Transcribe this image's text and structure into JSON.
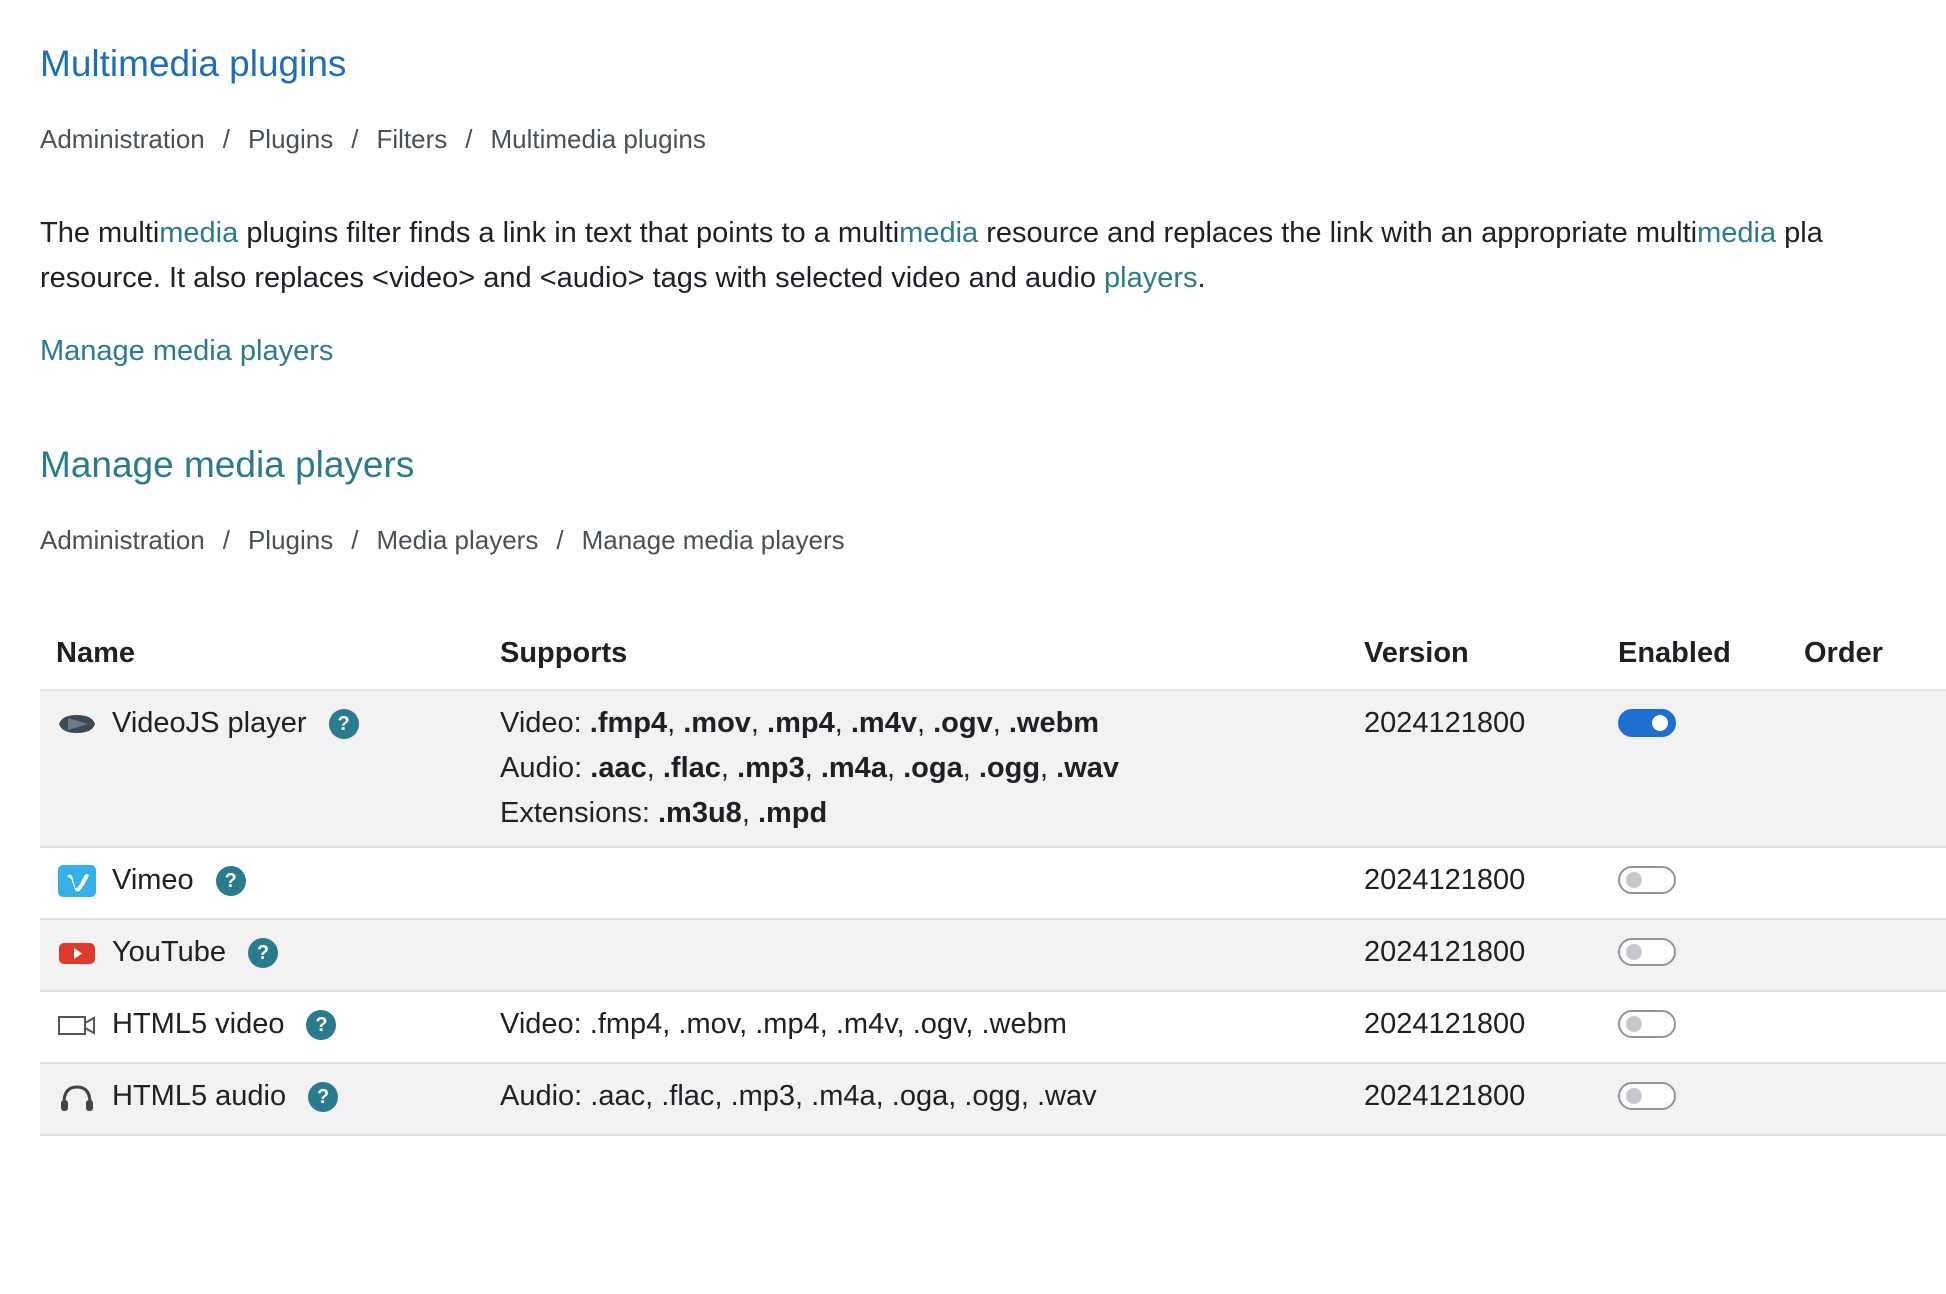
{
  "filter_section": {
    "title": "Multimedia plugins",
    "breadcrumb": [
      "Administration",
      "Plugins",
      "Filters",
      "Multimedia plugins"
    ],
    "breadcrumb_separator": "/",
    "description": {
      "line1": [
        {
          "text": "The multi",
          "highlight": false
        },
        {
          "text": "media",
          "highlight": true
        },
        {
          "text": " plugins filter finds a link in text that points to a multi",
          "highlight": false
        },
        {
          "text": "media",
          "highlight": true
        },
        {
          "text": " resource and replaces the link with an appropriate multi",
          "highlight": false
        },
        {
          "text": "media",
          "highlight": true
        },
        {
          "text": " pla",
          "highlight": false
        }
      ],
      "line2": [
        {
          "text": "resource. It also replaces <video> and <audio> tags with selected video and audio ",
          "highlight": false
        },
        {
          "text": "players",
          "highlight": true
        },
        {
          "text": ".",
          "highlight": false
        }
      ]
    },
    "manage_link": "Manage media players"
  },
  "players_section": {
    "title": "Manage media players",
    "breadcrumb": [
      "Administration",
      "Plugins",
      "Media players",
      "Manage media players"
    ],
    "breadcrumb_separator": "/"
  },
  "table": {
    "headers": {
      "name": "Name",
      "supports": "Supports",
      "version": "Version",
      "enabled": "Enabled",
      "order": "Order"
    },
    "rows": [
      {
        "name": "VideoJS player",
        "icon": "videojs-icon",
        "supports_bold": true,
        "supports": [
          {
            "label": "Video: ",
            "formats": [
              ".fmp4",
              ".mov",
              ".mp4",
              ".m4v",
              ".ogv",
              ".webm"
            ]
          },
          {
            "label": "Audio: ",
            "formats": [
              ".aac",
              ".flac",
              ".mp3",
              ".m4a",
              ".oga",
              ".ogg",
              ".wav"
            ]
          },
          {
            "label": "Extensions: ",
            "formats": [
              ".m3u8",
              ".mpd"
            ]
          }
        ],
        "version": "2024121800",
        "enabled": true
      },
      {
        "name": "Vimeo",
        "icon": "vimeo-icon",
        "supports_bold": false,
        "supports": [],
        "version": "2024121800",
        "enabled": false
      },
      {
        "name": "YouTube",
        "icon": "youtube-icon",
        "supports_bold": false,
        "supports": [],
        "version": "2024121800",
        "enabled": false
      },
      {
        "name": "HTML5 video",
        "icon": "video-camera-icon",
        "supports_bold": false,
        "supports": [
          {
            "label": "Video: ",
            "formats": [
              ".fmp4",
              ".mov",
              ".mp4",
              ".m4v",
              ".ogv",
              ".webm"
            ]
          }
        ],
        "version": "2024121800",
        "enabled": false
      },
      {
        "name": "HTML5 audio",
        "icon": "headphones-icon",
        "supports_bold": false,
        "supports": [
          {
            "label": "Audio: ",
            "formats": [
              ".aac",
              ".flac",
              ".mp3",
              ".m4a",
              ".oga",
              ".ogg",
              ".wav"
            ]
          }
        ],
        "version": "2024121800",
        "enabled": false
      }
    ],
    "help_glyph": "?"
  },
  "colors": {
    "title_blue": "#1f6fb6",
    "link_teal": "#2b7b8f",
    "toggle_on": "#1f6fd0",
    "row_stripe": "#f2f2f2"
  }
}
